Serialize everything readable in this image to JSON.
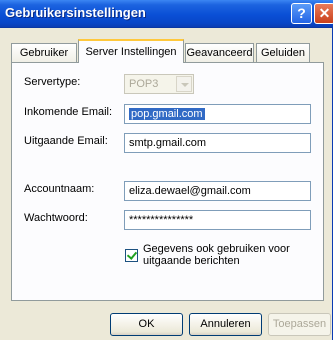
{
  "window": {
    "title": "Gebruikersinstellingen",
    "help_label": "?",
    "close_label": "✕"
  },
  "tabs": [
    {
      "label": "Gebruiker"
    },
    {
      "label": "Server Instellingen"
    },
    {
      "label": "Geavanceerd"
    },
    {
      "label": "Geluiden"
    }
  ],
  "form": {
    "servertype": {
      "label": "Servertype:",
      "value": "POP3"
    },
    "incoming": {
      "label": "Inkomende Email:",
      "value": "pop.gmail.com"
    },
    "outgoing": {
      "label": "Uitgaande Email:",
      "value": "smtp.gmail.com"
    },
    "account": {
      "label": "Accountnaam:",
      "value": "eliza.dewael@gmail.com"
    },
    "password": {
      "label": "Wachtwoord:",
      "value": "***************"
    },
    "use_for_outgoing": {
      "label_line1": "Gegevens ook gebruiken voor",
      "label_line2": "uitgaande berichten",
      "checked": true
    }
  },
  "buttons": {
    "ok": "OK",
    "cancel": "Annuleren",
    "apply": "Toepassen"
  },
  "colors": {
    "titlebar": "#0a4fd6",
    "selection": "#316ac5",
    "dialog_bg": "#ece9d8"
  }
}
